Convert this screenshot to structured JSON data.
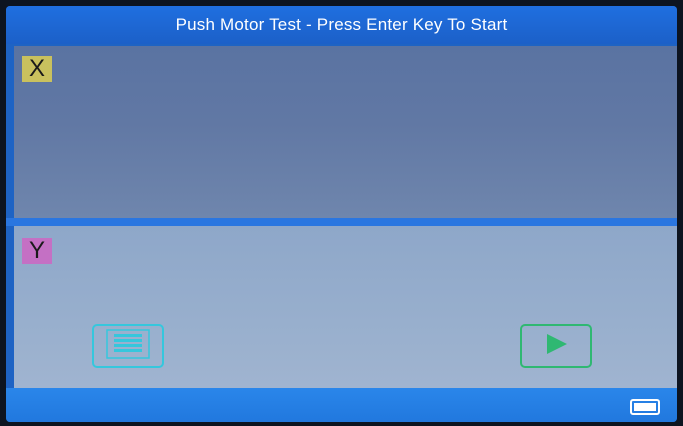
{
  "header": {
    "title": "Push Motor Test - Press Enter Key To Start"
  },
  "panels": {
    "x": {
      "label": "X"
    },
    "y": {
      "label": "Y"
    }
  },
  "buttons": {
    "menu": {
      "icon": "menu-list-icon"
    },
    "start": {
      "icon": "play-icon"
    }
  },
  "status": {
    "battery_icon": "battery-icon"
  },
  "colors": {
    "title_bar": "#1f6fe0",
    "panel_x": "#6178a4",
    "panel_y": "#98afcd",
    "x_label_bg": "#c9c15e",
    "y_label_bg": "#c470c4",
    "menu_button": "#35c7dd",
    "start_button": "#2fb872"
  }
}
